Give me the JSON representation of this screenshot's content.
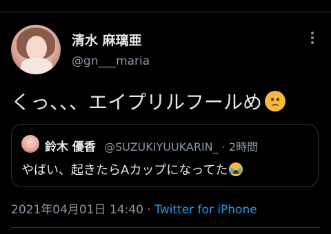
{
  "tweet": {
    "author": {
      "display_name": "清水 麻璃亜",
      "handle": "@gn___maria"
    },
    "text": "くっ、、、エイプリルフールめ",
    "emoji": "confused-face",
    "quoted_tweet": {
      "display_name": "鈴木 優香",
      "handle": "@SUZUKIYUUKARIN_",
      "separator": " · ",
      "time_ago": "2時間",
      "text": "やばい、起きたらAカップになってた",
      "emoji": "loudly-crying-face"
    },
    "timestamp": "2021年04月01日 14:40",
    "meta_separator": " · ",
    "source": "Twitter for iPhone"
  },
  "colors": {
    "background": "#000000",
    "primary_text": "#e7e9ea",
    "secondary_text": "#8b98a5",
    "link": "#1d9bf0",
    "border": "#2f3336"
  }
}
